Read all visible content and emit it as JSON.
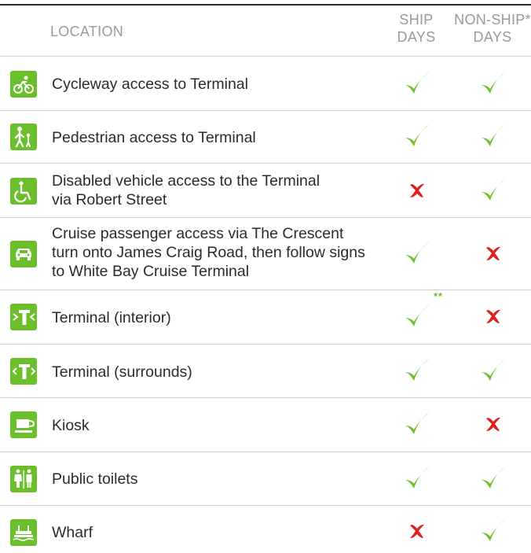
{
  "header": {
    "location": "LOCATION",
    "ship_line1": "SHIP",
    "ship_line2": "DAYS",
    "nonship_line1": "NON-SHIP*",
    "nonship_line2": "DAYS"
  },
  "colors": {
    "accent": "#6bbf2a",
    "cross": "#e02020",
    "text": "#2b2b2b",
    "header": "#9a9a9a"
  },
  "rows": [
    {
      "icon": "cycle-icon",
      "line1": "Cycleway access to Terminal",
      "ship": "check",
      "nonship": "check"
    },
    {
      "icon": "pedestrian-icon",
      "line1": "Pedestrian access to Terminal",
      "ship": "check",
      "nonship": "check"
    },
    {
      "icon": "wheelchair-icon",
      "line1": "Disabled vehicle access to the Terminal",
      "line2": "via Robert Street",
      "ship": "cross",
      "nonship": "check"
    },
    {
      "icon": "car-icon",
      "line1": "Cruise passenger access via The Crescent",
      "line2": "turn onto James Craig Road, then follow signs",
      "line3": "to White Bay Cruise Terminal",
      "ship": "check",
      "nonship": "cross"
    },
    {
      "icon": "terminal-interior-icon",
      "line1": "Terminal (interior)",
      "ship": "check",
      "ship_note": "**",
      "nonship": "cross"
    },
    {
      "icon": "terminal-surrounds-icon",
      "line1": "Terminal (surrounds)",
      "ship": "check",
      "nonship": "check"
    },
    {
      "icon": "kiosk-icon",
      "line1": "Kiosk",
      "ship": "check",
      "nonship": "cross"
    },
    {
      "icon": "toilets-icon",
      "line1": "Public toilets",
      "ship": "check",
      "nonship": "check"
    },
    {
      "icon": "wharf-icon",
      "line1": "Wharf",
      "ship": "cross",
      "nonship": "check"
    }
  ]
}
